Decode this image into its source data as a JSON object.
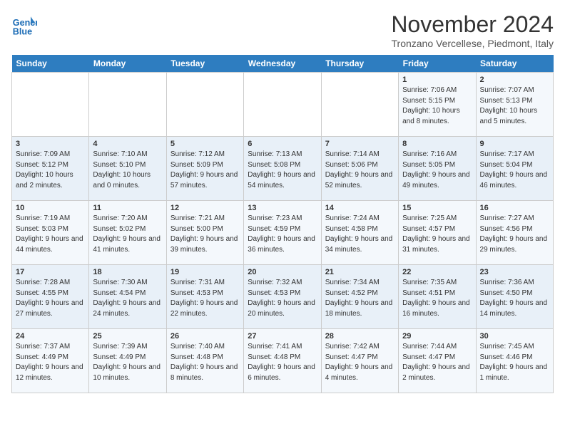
{
  "header": {
    "logo_line1": "General",
    "logo_line2": "Blue",
    "month": "November 2024",
    "location": "Tronzano Vercellese, Piedmont, Italy"
  },
  "weekdays": [
    "Sunday",
    "Monday",
    "Tuesday",
    "Wednesday",
    "Thursday",
    "Friday",
    "Saturday"
  ],
  "weeks": [
    [
      {
        "day": "",
        "info": ""
      },
      {
        "day": "",
        "info": ""
      },
      {
        "day": "",
        "info": ""
      },
      {
        "day": "",
        "info": ""
      },
      {
        "day": "",
        "info": ""
      },
      {
        "day": "1",
        "info": "Sunrise: 7:06 AM\nSunset: 5:15 PM\nDaylight: 10 hours and 8 minutes."
      },
      {
        "day": "2",
        "info": "Sunrise: 7:07 AM\nSunset: 5:13 PM\nDaylight: 10 hours and 5 minutes."
      }
    ],
    [
      {
        "day": "3",
        "info": "Sunrise: 7:09 AM\nSunset: 5:12 PM\nDaylight: 10 hours and 2 minutes."
      },
      {
        "day": "4",
        "info": "Sunrise: 7:10 AM\nSunset: 5:10 PM\nDaylight: 10 hours and 0 minutes."
      },
      {
        "day": "5",
        "info": "Sunrise: 7:12 AM\nSunset: 5:09 PM\nDaylight: 9 hours and 57 minutes."
      },
      {
        "day": "6",
        "info": "Sunrise: 7:13 AM\nSunset: 5:08 PM\nDaylight: 9 hours and 54 minutes."
      },
      {
        "day": "7",
        "info": "Sunrise: 7:14 AM\nSunset: 5:06 PM\nDaylight: 9 hours and 52 minutes."
      },
      {
        "day": "8",
        "info": "Sunrise: 7:16 AM\nSunset: 5:05 PM\nDaylight: 9 hours and 49 minutes."
      },
      {
        "day": "9",
        "info": "Sunrise: 7:17 AM\nSunset: 5:04 PM\nDaylight: 9 hours and 46 minutes."
      }
    ],
    [
      {
        "day": "10",
        "info": "Sunrise: 7:19 AM\nSunset: 5:03 PM\nDaylight: 9 hours and 44 minutes."
      },
      {
        "day": "11",
        "info": "Sunrise: 7:20 AM\nSunset: 5:02 PM\nDaylight: 9 hours and 41 minutes."
      },
      {
        "day": "12",
        "info": "Sunrise: 7:21 AM\nSunset: 5:00 PM\nDaylight: 9 hours and 39 minutes."
      },
      {
        "day": "13",
        "info": "Sunrise: 7:23 AM\nSunset: 4:59 PM\nDaylight: 9 hours and 36 minutes."
      },
      {
        "day": "14",
        "info": "Sunrise: 7:24 AM\nSunset: 4:58 PM\nDaylight: 9 hours and 34 minutes."
      },
      {
        "day": "15",
        "info": "Sunrise: 7:25 AM\nSunset: 4:57 PM\nDaylight: 9 hours and 31 minutes."
      },
      {
        "day": "16",
        "info": "Sunrise: 7:27 AM\nSunset: 4:56 PM\nDaylight: 9 hours and 29 minutes."
      }
    ],
    [
      {
        "day": "17",
        "info": "Sunrise: 7:28 AM\nSunset: 4:55 PM\nDaylight: 9 hours and 27 minutes."
      },
      {
        "day": "18",
        "info": "Sunrise: 7:30 AM\nSunset: 4:54 PM\nDaylight: 9 hours and 24 minutes."
      },
      {
        "day": "19",
        "info": "Sunrise: 7:31 AM\nSunset: 4:53 PM\nDaylight: 9 hours and 22 minutes."
      },
      {
        "day": "20",
        "info": "Sunrise: 7:32 AM\nSunset: 4:53 PM\nDaylight: 9 hours and 20 minutes."
      },
      {
        "day": "21",
        "info": "Sunrise: 7:34 AM\nSunset: 4:52 PM\nDaylight: 9 hours and 18 minutes."
      },
      {
        "day": "22",
        "info": "Sunrise: 7:35 AM\nSunset: 4:51 PM\nDaylight: 9 hours and 16 minutes."
      },
      {
        "day": "23",
        "info": "Sunrise: 7:36 AM\nSunset: 4:50 PM\nDaylight: 9 hours and 14 minutes."
      }
    ],
    [
      {
        "day": "24",
        "info": "Sunrise: 7:37 AM\nSunset: 4:49 PM\nDaylight: 9 hours and 12 minutes."
      },
      {
        "day": "25",
        "info": "Sunrise: 7:39 AM\nSunset: 4:49 PM\nDaylight: 9 hours and 10 minutes."
      },
      {
        "day": "26",
        "info": "Sunrise: 7:40 AM\nSunset: 4:48 PM\nDaylight: 9 hours and 8 minutes."
      },
      {
        "day": "27",
        "info": "Sunrise: 7:41 AM\nSunset: 4:48 PM\nDaylight: 9 hours and 6 minutes."
      },
      {
        "day": "28",
        "info": "Sunrise: 7:42 AM\nSunset: 4:47 PM\nDaylight: 9 hours and 4 minutes."
      },
      {
        "day": "29",
        "info": "Sunrise: 7:44 AM\nSunset: 4:47 PM\nDaylight: 9 hours and 2 minutes."
      },
      {
        "day": "30",
        "info": "Sunrise: 7:45 AM\nSunset: 4:46 PM\nDaylight: 9 hours and 1 minute."
      }
    ]
  ]
}
